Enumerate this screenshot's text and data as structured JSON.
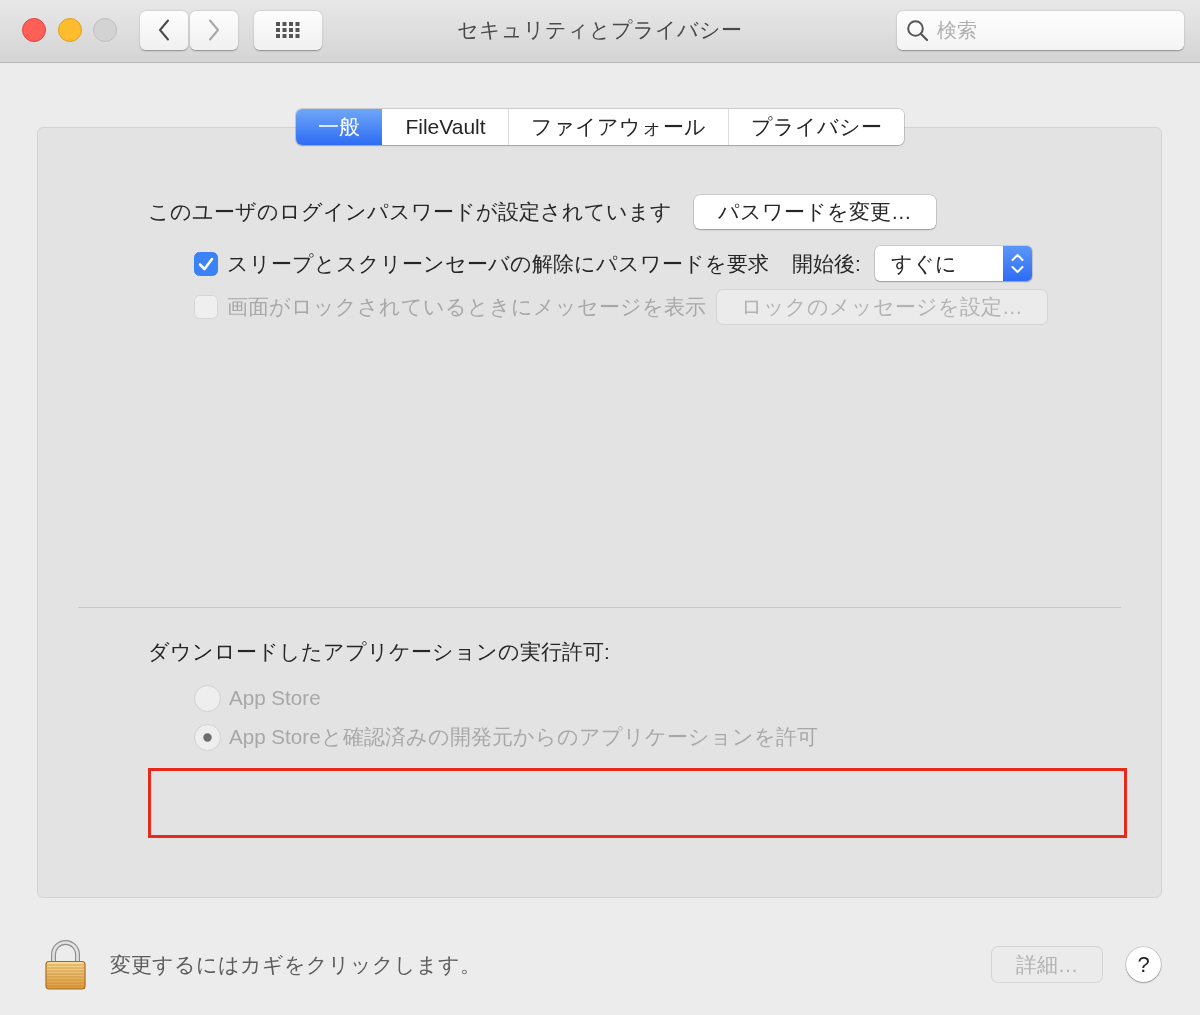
{
  "window": {
    "title": "セキュリティとプライバシー",
    "buttons": [
      {
        "kind": "close",
        "disabled": false
      },
      {
        "kind": "minimize",
        "disabled": false
      },
      {
        "kind": "zoom",
        "disabled": true
      }
    ]
  },
  "toolbar": {
    "nav": [
      {
        "kind": "back",
        "disabled": false
      },
      {
        "kind": "forward",
        "disabled": true
      }
    ],
    "search": {
      "placeholder": "検索"
    }
  },
  "tabs": [
    {
      "label": "一般",
      "selected": true
    },
    {
      "label": "FileVault",
      "selected": false
    },
    {
      "label": "ファイアウォール",
      "selected": false
    },
    {
      "label": "プライバシー",
      "selected": false
    }
  ],
  "password": {
    "label": "このユーザのログインパスワードが設定されています",
    "button": {
      "label": "パスワードを変更…",
      "disabled": false
    }
  },
  "sleep_lock": {
    "checkbox": {
      "label": "スリープとスクリーンセーバの解除にパスワードを要求",
      "checked": true,
      "disabled": false
    },
    "delay_label": "開始後:",
    "delay_popup": {
      "value": "すぐに"
    }
  },
  "lock_message": {
    "checkbox": {
      "label": "画面がロックされているときにメッセージを表示",
      "checked": false,
      "disabled": true
    },
    "button": {
      "label": "ロックのメッセージを設定…",
      "disabled": true
    }
  },
  "downloads": {
    "label": "ダウンロードしたアプリケーションの実行許可:",
    "options": [
      {
        "label": "App Store",
        "selected": false,
        "disabled": true
      },
      {
        "label": "App Storeと確認済みの開発元からのアプリケーションを許可",
        "selected": true,
        "disabled": true
      }
    ],
    "annotations": [
      {
        "kind": "frame"
      }
    ]
  },
  "footer": {
    "lock_text": "変更するにはカギをクリックします。",
    "advanced_button": {
      "label": "詳細…",
      "disabled": true
    },
    "help_button": {
      "label": "?"
    }
  }
}
